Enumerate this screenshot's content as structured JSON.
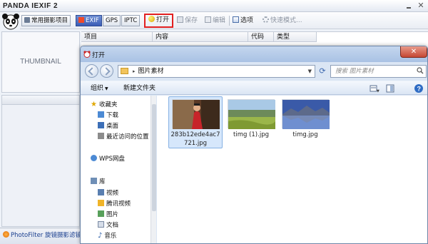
{
  "app": {
    "title": "PANDA IEXIF 2",
    "tabs": [
      "常用摄影项目",
      "EXIF",
      "GPS",
      "IPTC"
    ],
    "toolbar": {
      "open": "打开",
      "save": "保存",
      "edit": "编辑",
      "options": "选项",
      "quick_mode": "快速模式..."
    },
    "thumbnail_label": "THUMBNAIL",
    "table_columns": [
      "项目",
      "内容",
      "代码",
      "类型"
    ],
    "photofilter_label": "PhotoFilter 旋镜摄影滤镜"
  },
  "dialog": {
    "title": "打开",
    "address": "图片素材",
    "search_placeholder": "搜索 图片素材",
    "organize": "组织",
    "new_folder": "新建文件夹",
    "nav": {
      "favorites": "收藏夹",
      "favorites_items": [
        "下载",
        "桌面",
        "最近访问的位置"
      ],
      "wps": "WPS网盘",
      "library": "库",
      "library_items": [
        "视频",
        "腾讯视频",
        "图片",
        "文档",
        "音乐"
      ]
    },
    "files": [
      {
        "name_line1": "283b12ede4ac7",
        "name_line2": "721.jpg",
        "selected": true
      },
      {
        "name_line1": "timg (1).jpg",
        "name_line2": "",
        "selected": false
      },
      {
        "name_line1": "timg.jpg",
        "name_line2": "",
        "selected": false
      }
    ]
  },
  "colors": {
    "exif_tab": "#3b5db6",
    "open_highlight": "#e22020",
    "selection": "#d6e7fb",
    "close_button": "#c54733"
  }
}
